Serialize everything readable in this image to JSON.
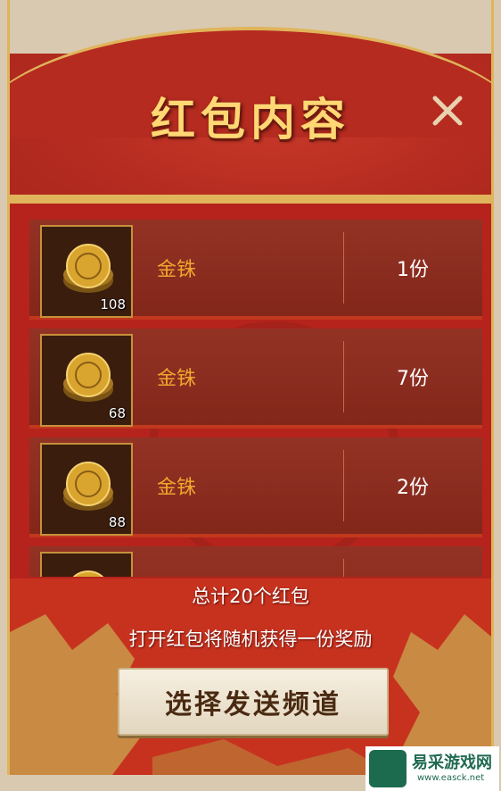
{
  "dialog": {
    "title": "红包内容",
    "close_icon": "close-icon"
  },
  "items": [
    {
      "name": "金铢",
      "count": "108",
      "qty": "1份"
    },
    {
      "name": "金铢",
      "count": "68",
      "qty": "7份"
    },
    {
      "name": "金铢",
      "count": "88",
      "qty": "2份"
    },
    {
      "name": "",
      "count": "",
      "qty": ""
    }
  ],
  "summary": {
    "total": "总计20个红包",
    "note": "打开红包将随机获得一份奖励"
  },
  "actions": {
    "choose_channel": "选择发送频道"
  },
  "watermark": {
    "site_name": "易采游戏网",
    "site_url": "www.easck.net"
  },
  "colors": {
    "panel_red": "#b5231c",
    "gold_accent": "#e0b45a",
    "title_gold": "#ffd874",
    "item_name_orange": "#f0a72f"
  }
}
